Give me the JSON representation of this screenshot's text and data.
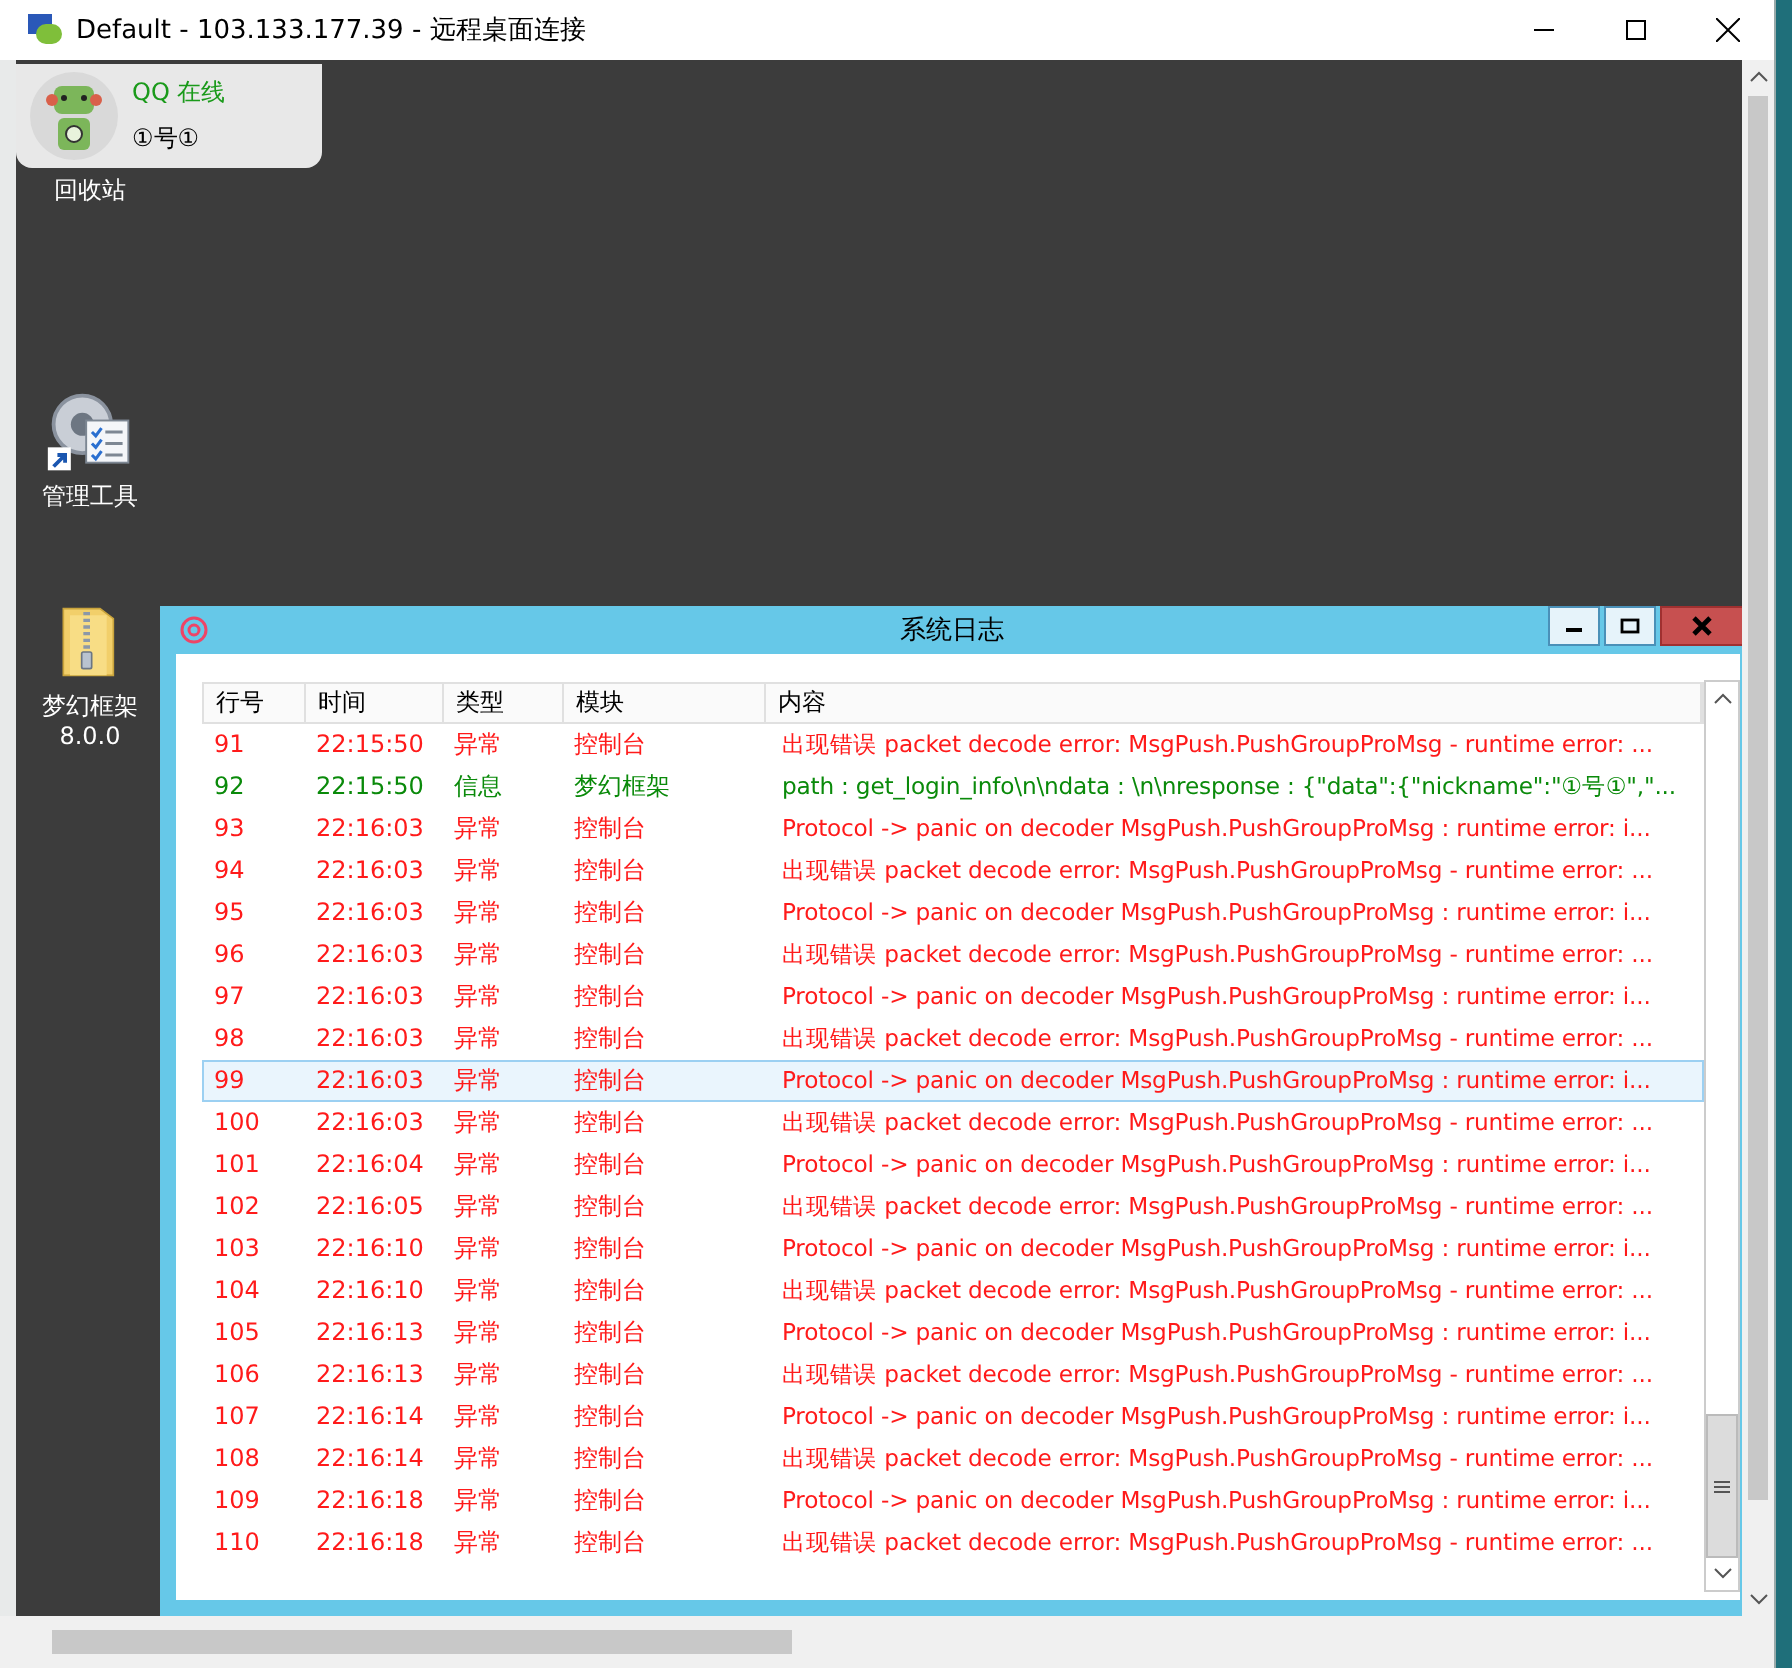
{
  "window": {
    "title": "Default - 103.133.177.39 - 远程桌面连接"
  },
  "qq_card": {
    "status": "QQ 在线",
    "nickname": "①号①"
  },
  "desktop_icons": [
    {
      "kind": "recycle",
      "label": "回收站"
    },
    {
      "kind": "tools",
      "label": "管理工具"
    },
    {
      "kind": "zip",
      "label": "梦幻框架\n8.0.0"
    }
  ],
  "log_window": {
    "title": "系统日志",
    "columns": [
      "行号",
      "时间",
      "类型",
      "模块",
      "内容"
    ],
    "rows": [
      {
        "no": "91",
        "time": "22:15:50",
        "type": "异常",
        "module": "控制台",
        "content": "出现错误 packet decode error: MsgPush.PushGroupProMsg - runtime error: ...",
        "kind": "error",
        "selected": false
      },
      {
        "no": "92",
        "time": "22:15:50",
        "type": "信息",
        "module": "梦幻框架",
        "content": "path : get_login_info\\n\\ndata : \\n\\nresponse : {\"data\":{\"nickname\":\"①号①\",\"...",
        "kind": "info",
        "selected": false
      },
      {
        "no": "93",
        "time": "22:16:03",
        "type": "异常",
        "module": "控制台",
        "content": "Protocol -> panic on decoder MsgPush.PushGroupProMsg : runtime error: i...",
        "kind": "error",
        "selected": false
      },
      {
        "no": "94",
        "time": "22:16:03",
        "type": "异常",
        "module": "控制台",
        "content": "出现错误 packet decode error: MsgPush.PushGroupProMsg - runtime error: ...",
        "kind": "error",
        "selected": false
      },
      {
        "no": "95",
        "time": "22:16:03",
        "type": "异常",
        "module": "控制台",
        "content": "Protocol -> panic on decoder MsgPush.PushGroupProMsg : runtime error: i...",
        "kind": "error",
        "selected": false
      },
      {
        "no": "96",
        "time": "22:16:03",
        "type": "异常",
        "module": "控制台",
        "content": "出现错误 packet decode error: MsgPush.PushGroupProMsg - runtime error: ...",
        "kind": "error",
        "selected": false
      },
      {
        "no": "97",
        "time": "22:16:03",
        "type": "异常",
        "module": "控制台",
        "content": "Protocol -> panic on decoder MsgPush.PushGroupProMsg : runtime error: i...",
        "kind": "error",
        "selected": false
      },
      {
        "no": "98",
        "time": "22:16:03",
        "type": "异常",
        "module": "控制台",
        "content": "出现错误 packet decode error: MsgPush.PushGroupProMsg - runtime error: ...",
        "kind": "error",
        "selected": false
      },
      {
        "no": "99",
        "time": "22:16:03",
        "type": "异常",
        "module": "控制台",
        "content": "Protocol -> panic on decoder MsgPush.PushGroupProMsg : runtime error: i...",
        "kind": "error",
        "selected": true
      },
      {
        "no": "100",
        "time": "22:16:03",
        "type": "异常",
        "module": "控制台",
        "content": "出现错误 packet decode error: MsgPush.PushGroupProMsg - runtime error: ...",
        "kind": "error",
        "selected": false
      },
      {
        "no": "101",
        "time": "22:16:04",
        "type": "异常",
        "module": "控制台",
        "content": "Protocol -> panic on decoder MsgPush.PushGroupProMsg : runtime error: i...",
        "kind": "error",
        "selected": false
      },
      {
        "no": "102",
        "time": "22:16:05",
        "type": "异常",
        "module": "控制台",
        "content": "出现错误 packet decode error: MsgPush.PushGroupProMsg - runtime error: ...",
        "kind": "error",
        "selected": false
      },
      {
        "no": "103",
        "time": "22:16:10",
        "type": "异常",
        "module": "控制台",
        "content": "Protocol -> panic on decoder MsgPush.PushGroupProMsg : runtime error: i...",
        "kind": "error",
        "selected": false
      },
      {
        "no": "104",
        "time": "22:16:10",
        "type": "异常",
        "module": "控制台",
        "content": "出现错误 packet decode error: MsgPush.PushGroupProMsg - runtime error: ...",
        "kind": "error",
        "selected": false
      },
      {
        "no": "105",
        "time": "22:16:13",
        "type": "异常",
        "module": "控制台",
        "content": "Protocol -> panic on decoder MsgPush.PushGroupProMsg : runtime error: i...",
        "kind": "error",
        "selected": false
      },
      {
        "no": "106",
        "time": "22:16:13",
        "type": "异常",
        "module": "控制台",
        "content": "出现错误 packet decode error: MsgPush.PushGroupProMsg - runtime error: ...",
        "kind": "error",
        "selected": false
      },
      {
        "no": "107",
        "time": "22:16:14",
        "type": "异常",
        "module": "控制台",
        "content": "Protocol -> panic on decoder MsgPush.PushGroupProMsg : runtime error: i...",
        "kind": "error",
        "selected": false
      },
      {
        "no": "108",
        "time": "22:16:14",
        "type": "异常",
        "module": "控制台",
        "content": "出现错误 packet decode error: MsgPush.PushGroupProMsg - runtime error: ...",
        "kind": "error",
        "selected": false
      },
      {
        "no": "109",
        "time": "22:16:18",
        "type": "异常",
        "module": "控制台",
        "content": "Protocol -> panic on decoder MsgPush.PushGroupProMsg : runtime error: i...",
        "kind": "error",
        "selected": false
      },
      {
        "no": "110",
        "time": "22:16:18",
        "type": "异常",
        "module": "控制台",
        "content": "出现错误 packet decode error: MsgPush.PushGroupProMsg - runtime error: ...",
        "kind": "error",
        "selected": false
      }
    ]
  }
}
